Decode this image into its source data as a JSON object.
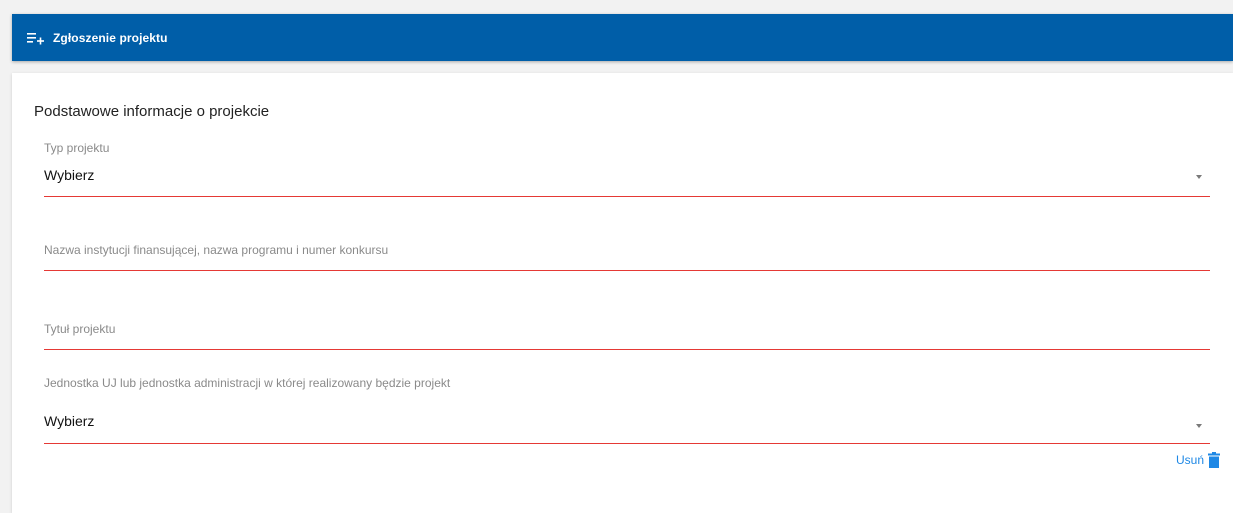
{
  "header": {
    "title": "Zgłoszenie projektu",
    "icon": "playlist-add-icon",
    "background_color": "#005ea8"
  },
  "form": {
    "section_title": "Podstawowe informacje o projekcie",
    "project_type": {
      "label": "Typ projektu",
      "value": "Wybierz"
    },
    "funding_institution": {
      "placeholder": "Nazwa instytucji finansującej, nazwa programu i numer konkursu"
    },
    "project_title": {
      "placeholder": "Tytuł projektu"
    },
    "unit": {
      "label": "Jednostka UJ lub jednostka administracji w której realizowany będzie projekt",
      "value": "Wybierz"
    },
    "remove_label": "Usuń",
    "underline_color": "#e53935",
    "link_color": "#1e88e5"
  }
}
